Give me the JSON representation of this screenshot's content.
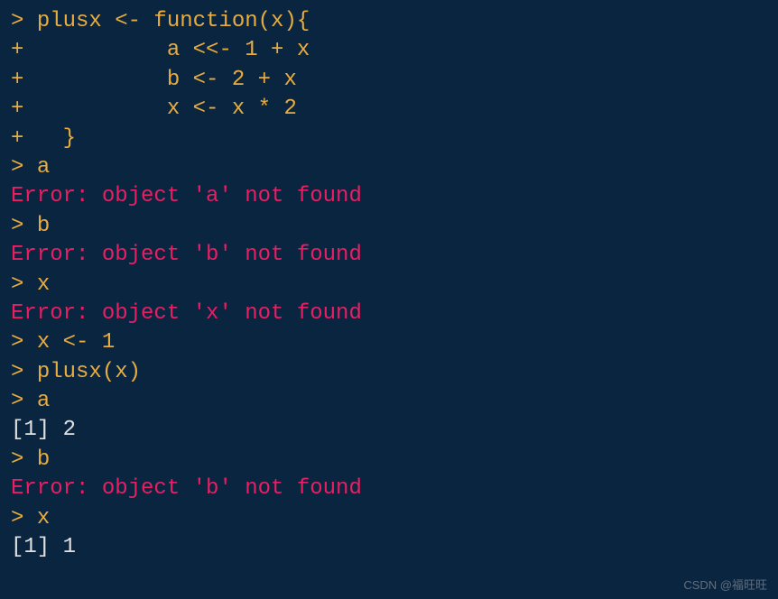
{
  "console": {
    "lines": [
      {
        "type": "input",
        "prompt": "> ",
        "text": "plusx <- function(x){"
      },
      {
        "type": "input",
        "prompt": "+ ",
        "text": "          a <<- 1 + x"
      },
      {
        "type": "input",
        "prompt": "+ ",
        "text": "          b <- 2 + x"
      },
      {
        "type": "input",
        "prompt": "+ ",
        "text": "          x <- x * 2"
      },
      {
        "type": "input",
        "prompt": "+ ",
        "text": "  }"
      },
      {
        "type": "input",
        "prompt": "> ",
        "text": "a"
      },
      {
        "type": "error",
        "text": "Error: object 'a' not found"
      },
      {
        "type": "input",
        "prompt": "> ",
        "text": "b"
      },
      {
        "type": "error",
        "text": "Error: object 'b' not found"
      },
      {
        "type": "input",
        "prompt": "> ",
        "text": "x"
      },
      {
        "type": "error",
        "text": "Error: object 'x' not found"
      },
      {
        "type": "input",
        "prompt": "> ",
        "text": "x <- 1"
      },
      {
        "type": "input",
        "prompt": "> ",
        "text": "plusx(x)"
      },
      {
        "type": "input",
        "prompt": "> ",
        "text": "a"
      },
      {
        "type": "output",
        "text": "[1] 2"
      },
      {
        "type": "input",
        "prompt": "> ",
        "text": "b"
      },
      {
        "type": "error",
        "text": "Error: object 'b' not found"
      },
      {
        "type": "input",
        "prompt": "> ",
        "text": "x"
      },
      {
        "type": "output",
        "text": "[1] 1"
      }
    ]
  },
  "watermark": "CSDN @福旺旺"
}
